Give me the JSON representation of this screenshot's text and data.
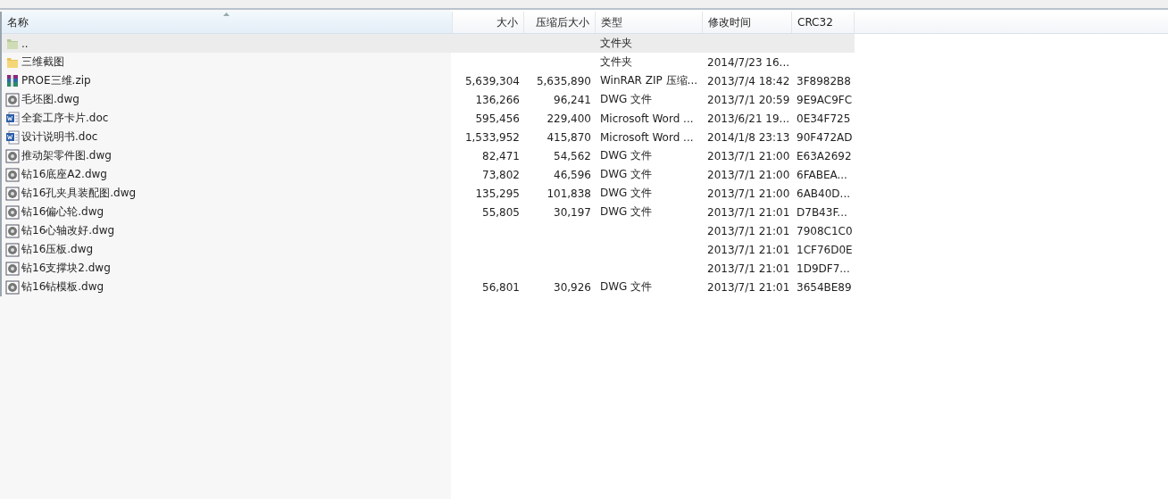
{
  "table": {
    "columns": [
      {
        "label": "名称",
        "sorted": true
      },
      {
        "label": "大小",
        "sorted": false
      },
      {
        "label": "压缩后大小",
        "sorted": false
      },
      {
        "label": "类型",
        "sorted": false
      },
      {
        "label": "修改时间",
        "sorted": false
      },
      {
        "label": "CRC32",
        "sorted": false
      }
    ],
    "rows": [
      {
        "kind": "up",
        "name": "..",
        "type": "文件夹",
        "selected": true
      },
      {
        "kind": "folder",
        "name": "三维截图",
        "type": "文件夹",
        "modified": "2014/7/23 16...",
        "selected": false
      },
      {
        "kind": "zip",
        "name": "PROE三维.zip",
        "size": "5,639,304",
        "packed": "5,635,890",
        "type": "WinRAR ZIP 压缩...",
        "modified": "2013/7/4 18:42",
        "crc": "3F8982B8",
        "selected": false
      },
      {
        "kind": "dwg",
        "name": "毛坯图.dwg",
        "size": "136,266",
        "packed": "96,241",
        "type": "DWG 文件",
        "modified": "2013/7/1 20:59",
        "crc": "9E9AC9FC",
        "selected": false
      },
      {
        "kind": "doc",
        "name": "全套工序卡片.doc",
        "size": "595,456",
        "packed": "229,400",
        "type": "Microsoft Word ...",
        "modified": "2013/6/21 19...",
        "crc": "0E34F725",
        "selected": false
      },
      {
        "kind": "doc",
        "name": "设计说明书.doc",
        "size": "1,533,952",
        "packed": "415,870",
        "type": "Microsoft Word ...",
        "modified": "2014/1/8 23:13",
        "crc": "90F472AD",
        "selected": false
      },
      {
        "kind": "dwg",
        "name": "推动架零件图.dwg",
        "size": "82,471",
        "packed": "54,562",
        "type": "DWG 文件",
        "modified": "2013/7/1 21:00",
        "crc": "E63A2692",
        "selected": false
      },
      {
        "kind": "dwg",
        "name": "钻16底座A2.dwg",
        "size": "73,802",
        "packed": "46,596",
        "type": "DWG 文件",
        "modified": "2013/7/1 21:00",
        "crc": "6FABEA...",
        "selected": false
      },
      {
        "kind": "dwg",
        "name": "钻16孔夹具装配图.dwg",
        "size": "135,295",
        "packed": "101,838",
        "type": "DWG 文件",
        "modified": "2013/7/1 21:00",
        "crc": "6AB40D...",
        "selected": false
      },
      {
        "kind": "dwg",
        "name": "钻16偏心轮.dwg",
        "size": "55,805",
        "packed": "30,197",
        "type": "DWG 文件",
        "modified": "2013/7/1 21:01",
        "crc": "D7B43F...",
        "selected": false
      },
      {
        "kind": "dwg",
        "name": "钻16心轴改好.dwg",
        "modified": "2013/7/1 21:01",
        "crc": "7908C1C0",
        "selected": false
      },
      {
        "kind": "dwg",
        "name": "钻16压板.dwg",
        "modified": "2013/7/1 21:01",
        "crc": "1CF76D0E",
        "selected": false
      },
      {
        "kind": "dwg",
        "name": "钻16支撑块2.dwg",
        "modified": "2013/7/1 21:01",
        "crc": "1D9DF7...",
        "selected": false
      },
      {
        "kind": "dwg",
        "name": "钻16钻模板.dwg",
        "size": "56,801",
        "packed": "30,926",
        "type": "DWG 文件",
        "modified": "2013/7/1 21:01",
        "crc": "3654BE89",
        "selected": false
      }
    ]
  }
}
